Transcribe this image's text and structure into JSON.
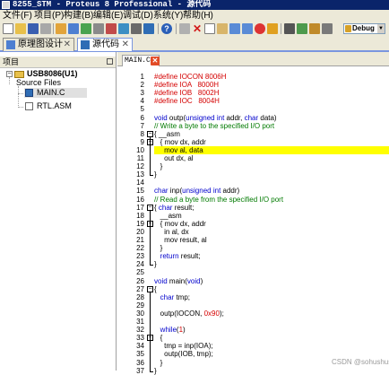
{
  "window": {
    "title": "8255_STM - Proteus 8 Professional - 源代码"
  },
  "menu": [
    "文件(F)",
    "项目(P)",
    "构建(B)",
    "编辑(E)",
    "调试(D)",
    "系统(Y)",
    "帮助(H)"
  ],
  "toolbar": {
    "icons": [
      "new-file-icon",
      "open-folder-icon",
      "save-icon",
      "close-project-icon",
      "home-icon",
      "schematic-icon",
      "pcb-icon",
      "3d-view-icon",
      "gerber-icon",
      "bom-icon",
      "design-explorer-icon",
      "source-code-icon",
      "help-icon",
      "cut-icon",
      "delete-icon",
      "copy-icon",
      "paste-icon",
      "undo-icon",
      "redo-icon",
      "stop-icon",
      "chip-icon",
      "build-icon",
      "rebuild-icon"
    ],
    "config_select": "Debug"
  },
  "doc_tabs": [
    {
      "label": "原理图设计",
      "active": false
    },
    {
      "label": "源代码",
      "active": true
    }
  ],
  "project": {
    "header": "项目",
    "root": "USB8086(U1)",
    "folder": "Source Files",
    "files": [
      "MAIN.C",
      "RTL.ASM"
    ]
  },
  "editor": {
    "tab_label": "MAIN.C",
    "lines": [
      {
        "n": "1",
        "text": "#define IOCON 8006H",
        "color": "#d40000"
      },
      {
        "n": "2",
        "text": "#define IOA   8000H",
        "color": "#d40000"
      },
      {
        "n": "3",
        "text": "#define IOB   8002H",
        "color": "#d40000"
      },
      {
        "n": "4",
        "text": "#define IOC   8004H",
        "color": "#d40000"
      },
      {
        "n": "5",
        "text": "",
        "color": "#000000"
      },
      {
        "n": "6",
        "text": "void outp(unsigned int addr, char data)",
        "color": "#000000"
      },
      {
        "n": "7",
        "text": "// Write a byte to the specified I/O port",
        "color": "#007a00"
      },
      {
        "n": "8",
        "text": "{ __asm",
        "color": "#000000"
      },
      {
        "n": "9",
        "text": "   { mov dx, addr",
        "color": "#000000"
      },
      {
        "n": "10",
        "text": "     mov al, data",
        "color": "#000000"
      },
      {
        "n": "11",
        "text": "     out dx, al",
        "color": "#000000"
      },
      {
        "n": "12",
        "text": "   }",
        "color": "#000000"
      },
      {
        "n": "13",
        "text": "}",
        "color": "#000000"
      },
      {
        "n": "14",
        "text": "",
        "color": "#000000"
      },
      {
        "n": "15",
        "text": "char inp(unsigned int addr)",
        "color": "#000000"
      },
      {
        "n": "16",
        "text": "// Read a byte from the specified I/O port",
        "color": "#007a00"
      },
      {
        "n": "17",
        "text": "{ char result;",
        "color": "#000000"
      },
      {
        "n": "18",
        "text": "   __asm",
        "color": "#000000"
      },
      {
        "n": "19",
        "text": "   { mov dx, addr",
        "color": "#000000"
      },
      {
        "n": "20",
        "text": "     in al, dx",
        "color": "#000000"
      },
      {
        "n": "21",
        "text": "     mov result, al",
        "color": "#000000"
      },
      {
        "n": "22",
        "text": "   }",
        "color": "#000000"
      },
      {
        "n": "23",
        "text": "   return result;",
        "color": "#000000"
      },
      {
        "n": "24",
        "text": "}",
        "color": "#000000"
      },
      {
        "n": "25",
        "text": "",
        "color": "#000000"
      },
      {
        "n": "26",
        "text": "void main(void)",
        "color": "#000000"
      },
      {
        "n": "27",
        "text": "{",
        "color": "#000000"
      },
      {
        "n": "28",
        "text": "   char tmp;",
        "color": "#000000"
      },
      {
        "n": "29",
        "text": "",
        "color": "#000000"
      },
      {
        "n": "30",
        "text": "   outp(IOCON, 0x90);",
        "color": "#000000"
      },
      {
        "n": "31",
        "text": "",
        "color": "#000000"
      },
      {
        "n": "32",
        "text": "   while(1)",
        "color": "#000000"
      },
      {
        "n": "33",
        "text": "   {",
        "color": "#000000"
      },
      {
        "n": "34",
        "text": "     tmp = inp(IOA);",
        "color": "#000000"
      },
      {
        "n": "35",
        "text": "     outp(IOB, tmp);",
        "color": "#000000"
      },
      {
        "n": "36",
        "text": "   }",
        "color": "#000000"
      },
      {
        "n": "37",
        "text": "}",
        "color": "#000000"
      }
    ],
    "highlighted_line": "10",
    "colors": {
      "keyword": "#0000cc",
      "preprocessor": "#d40000",
      "comment": "#007a00",
      "highlight": "#ffff00"
    }
  },
  "watermark": "CSDN @sohushus"
}
